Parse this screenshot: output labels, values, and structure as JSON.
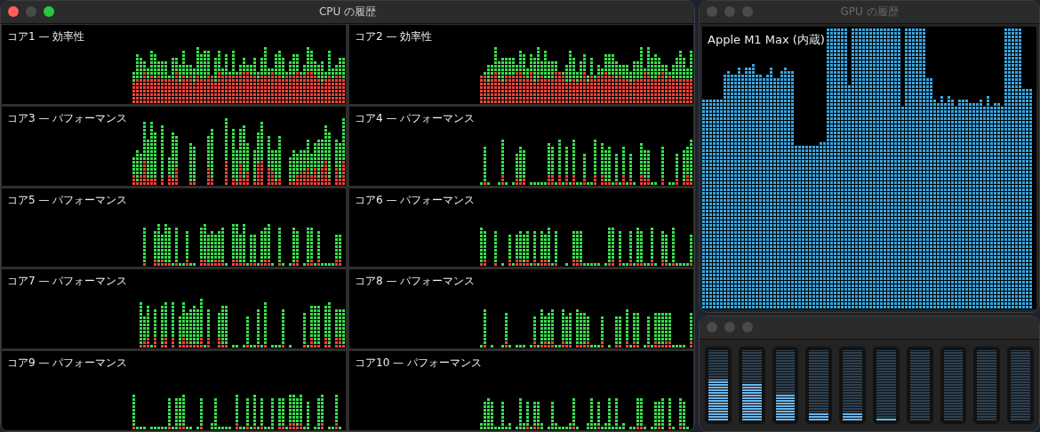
{
  "cpu_window": {
    "title": "CPU の履歴",
    "active": true,
    "cores": [
      {
        "label": "コア1 — 効率性"
      },
      {
        "label": "コア2 — 効率性"
      },
      {
        "label": "コア3 — パフォーマンス"
      },
      {
        "label": "コア4 — パフォーマンス"
      },
      {
        "label": "コア5 — パフォーマンス"
      },
      {
        "label": "コア6 — パフォーマンス"
      },
      {
        "label": "コア7 — パフォーマンス"
      },
      {
        "label": "コア8 — パフォーマンス"
      },
      {
        "label": "コア9 — パフォーマンス"
      },
      {
        "label": "コア10 — パフォーマンス"
      }
    ]
  },
  "gpu_window": {
    "title": "GPU の履歴",
    "active": false,
    "gpu_label": "Apple M1 Max (内蔵)"
  },
  "cpu_usage_window": {
    "active": false,
    "meters": [
      {
        "level": 0.58
      },
      {
        "level": 0.53
      },
      {
        "level": 0.38
      },
      {
        "level": 0.12
      },
      {
        "level": 0.12
      },
      {
        "level": 0.04
      }
    ]
  }
}
